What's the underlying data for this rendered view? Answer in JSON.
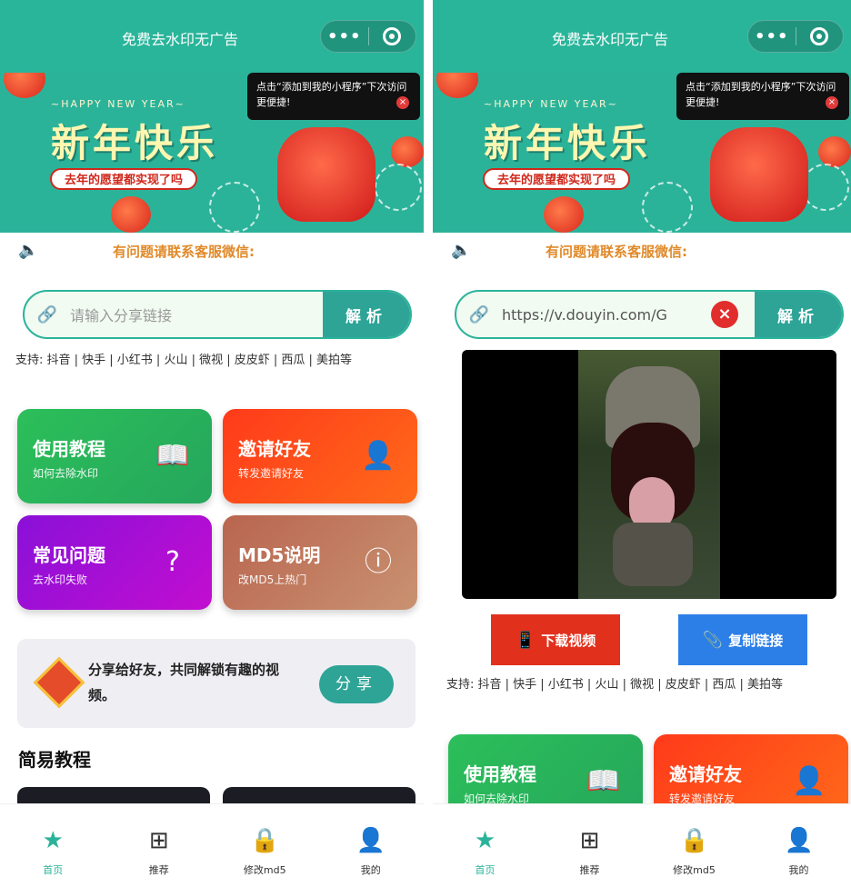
{
  "app": {
    "title": "免费去水印无广告",
    "capsule_more": "•••"
  },
  "banner": {
    "happy_new_year": "~HAPPY NEW YEAR~",
    "headline": "新年快乐",
    "wish": "去年的愿望都实现了吗",
    "tooltip": "点击“添加到我的小程序”下次访问更便捷!",
    "tooltip_close": "×"
  },
  "notice": {
    "text": "有问题请联系客服微信:"
  },
  "left": {
    "input": {
      "placeholder": "请输入分享链接"
    },
    "parse_label": "解析",
    "support": "支持: 抖音 | 快手 | 小红书 | 火山 | 微视 | 皮皮虾 | 西瓜 | 美拍等",
    "cards": [
      {
        "title": "使用教程",
        "sub": "如何去除水印"
      },
      {
        "title": "邀请好友",
        "sub": "转发邀请好友"
      },
      {
        "title": "常见问题",
        "sub": "去水印失败"
      },
      {
        "title": "MD5说明",
        "sub": "改MD5上热门"
      }
    ],
    "share": {
      "text": "分享给好友，共同解锁有趣的视频。",
      "button": "分享"
    },
    "section_title": "简易教程"
  },
  "right": {
    "input": {
      "value": "https://v.douyin.com/G"
    },
    "clear": "×",
    "parse_label": "解析",
    "download_label": "下载视频",
    "copy_label": "复制链接",
    "support": "支持: 抖音 | 快手 | 小红书 | 火山 | 微视 | 皮皮虾 | 西瓜 | 美拍等",
    "cards": [
      {
        "title": "使用教程",
        "sub": "如何去除水印"
      },
      {
        "title": "邀请好友",
        "sub": "转发邀请好友"
      }
    ]
  },
  "tabbar": {
    "items": [
      {
        "label": "首页",
        "icon": "star-icon",
        "active": true
      },
      {
        "label": "推荐",
        "icon": "grid-icon",
        "active": false
      },
      {
        "label": "修改md5",
        "icon": "lock-icon",
        "active": false
      },
      {
        "label": "我的",
        "icon": "user-icon",
        "active": false
      }
    ]
  },
  "colors": {
    "brand": "#2bb39a",
    "button": "#2ea497",
    "notice": "#e08a2a",
    "download": "#e1311d",
    "copy": "#2d7fe8"
  }
}
